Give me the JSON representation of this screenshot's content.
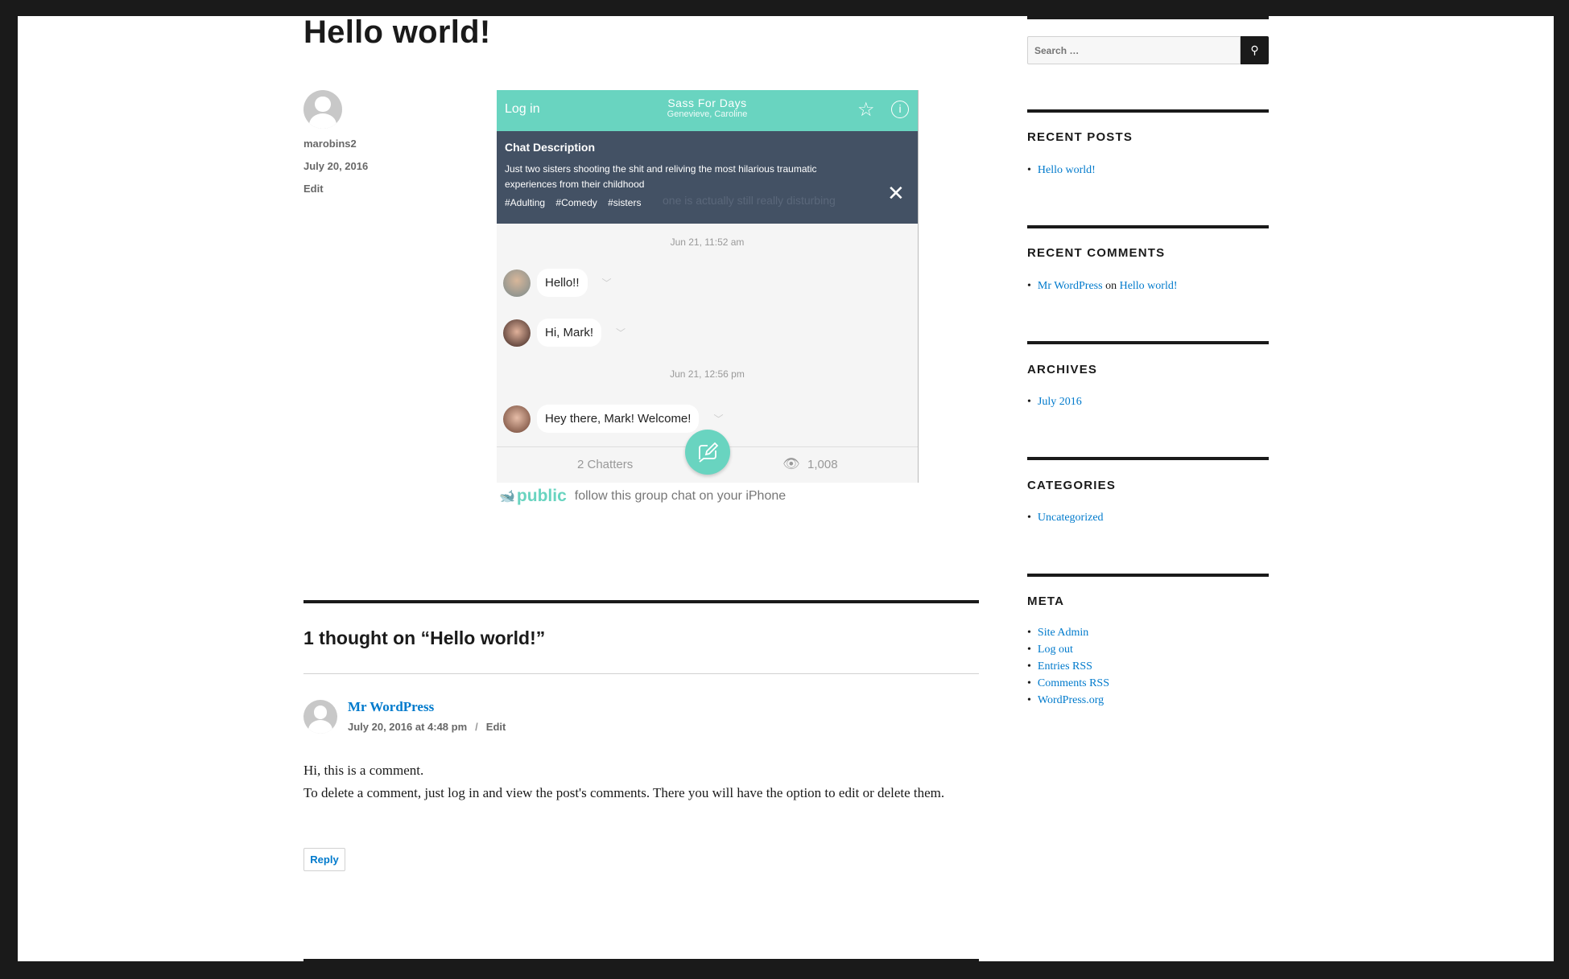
{
  "post": {
    "title": "Hello world!",
    "author": "marobins2",
    "date": "July 20, 2016",
    "edit": "Edit"
  },
  "chat": {
    "login": "Log in",
    "name": "Sass For Days",
    "members": "Genevieve, Caroline",
    "desc_title": "Chat Description",
    "desc_text": "Just two sisters shooting the shit and reliving the most hilarious traumatic experiences from their childhood",
    "tags": [
      "#Adulting",
      "#Comedy",
      "#sisters"
    ],
    "ghost_text": "one is actually still really disturbing",
    "timestamps": [
      "Jun 21, 11:52 am",
      "Jun 21, 12:56 pm"
    ],
    "messages": [
      "Hello!!",
      "Hi, Mark!",
      "Hey there, Mark! Welcome!"
    ],
    "chatters": "2 Chatters",
    "views": "1,008",
    "brand": "public",
    "follow": "follow this group chat on your iPhone",
    "accent": "#69d4c0",
    "panel": "#435164"
  },
  "comments": {
    "heading": "1 thought on “Hello world!”",
    "author": "Mr WordPress",
    "date": "July 20, 2016 at 4:48 pm",
    "sep": "/",
    "edit": "Edit",
    "line1": "Hi, this is a comment.",
    "line2": "To delete a comment, just log in and view the post's comments. There you will have the option to edit or delete them.",
    "reply": "Reply"
  },
  "sidebar": {
    "search_placeholder": "Search …",
    "recent_posts": {
      "title": "RECENT POSTS",
      "items": [
        "Hello world!"
      ]
    },
    "recent_comments": {
      "title": "RECENT COMMENTS",
      "author": "Mr WordPress",
      "on": "on",
      "post": "Hello world!"
    },
    "archives": {
      "title": "ARCHIVES",
      "items": [
        "July 2016"
      ]
    },
    "categories": {
      "title": "CATEGORIES",
      "items": [
        "Uncategorized"
      ]
    },
    "meta": {
      "title": "META",
      "items": [
        "Site Admin",
        "Log out",
        "Entries RSS",
        "Comments RSS",
        "WordPress.org"
      ]
    }
  }
}
